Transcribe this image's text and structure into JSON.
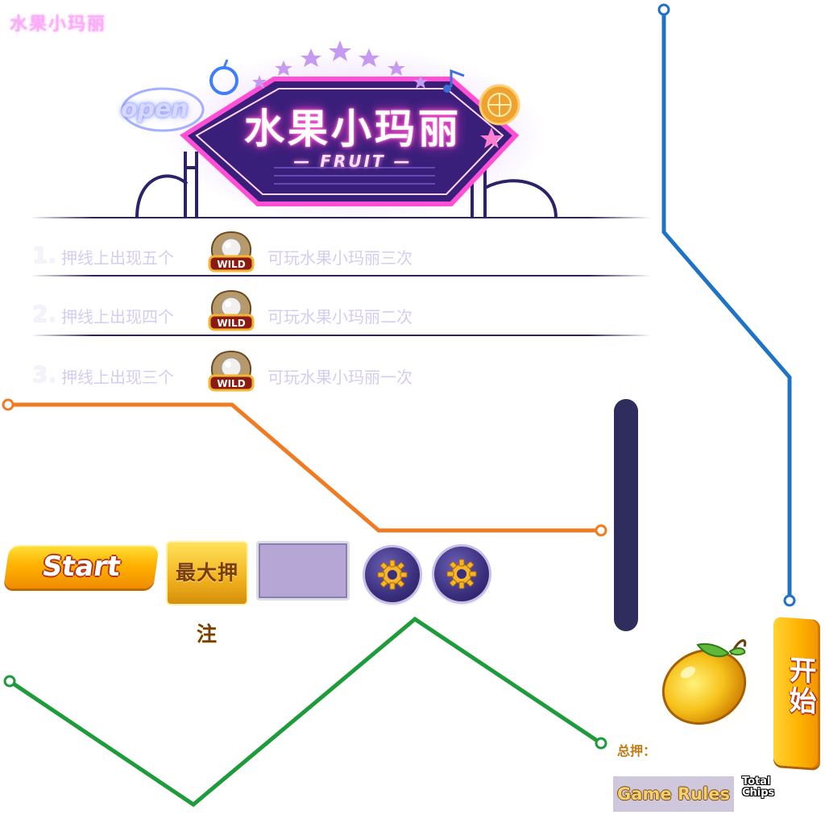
{
  "corner_title": "水果小玛丽",
  "logo": {
    "title": "水果小玛丽",
    "subtitle": "— FRUIT —",
    "sign_word": "open"
  },
  "rules": [
    {
      "num": "1.",
      "before": "押线上出现五个",
      "after": "可玩水果小玛丽三次",
      "badge": "WILD"
    },
    {
      "num": "2.",
      "before": "押线上出现四个",
      "after": "可玩水果小玛丽二次",
      "badge": "WILD"
    },
    {
      "num": "3.",
      "before": "押线上出现三个",
      "after": "可玩水果小玛丽一次",
      "badge": "WILD"
    }
  ],
  "controls": {
    "start_label": "Start",
    "max_bet_label": "最大押注",
    "kaishi_label": "开始",
    "total_bet_label": "总押：",
    "game_rules_label": "Game Rules",
    "total_chips_label": "Total Chips"
  },
  "icons": {
    "gear1": "gear-icon",
    "gear2": "gear-icon",
    "lemon": "lemon-icon",
    "wild": "pearl-wild-icon"
  },
  "colors": {
    "line_blue": "#1f73c6",
    "line_orange": "#ef7c23",
    "line_green": "#1e9b3a",
    "navy": "#2f2c5e",
    "neon_pink": "#ff3bc4"
  }
}
